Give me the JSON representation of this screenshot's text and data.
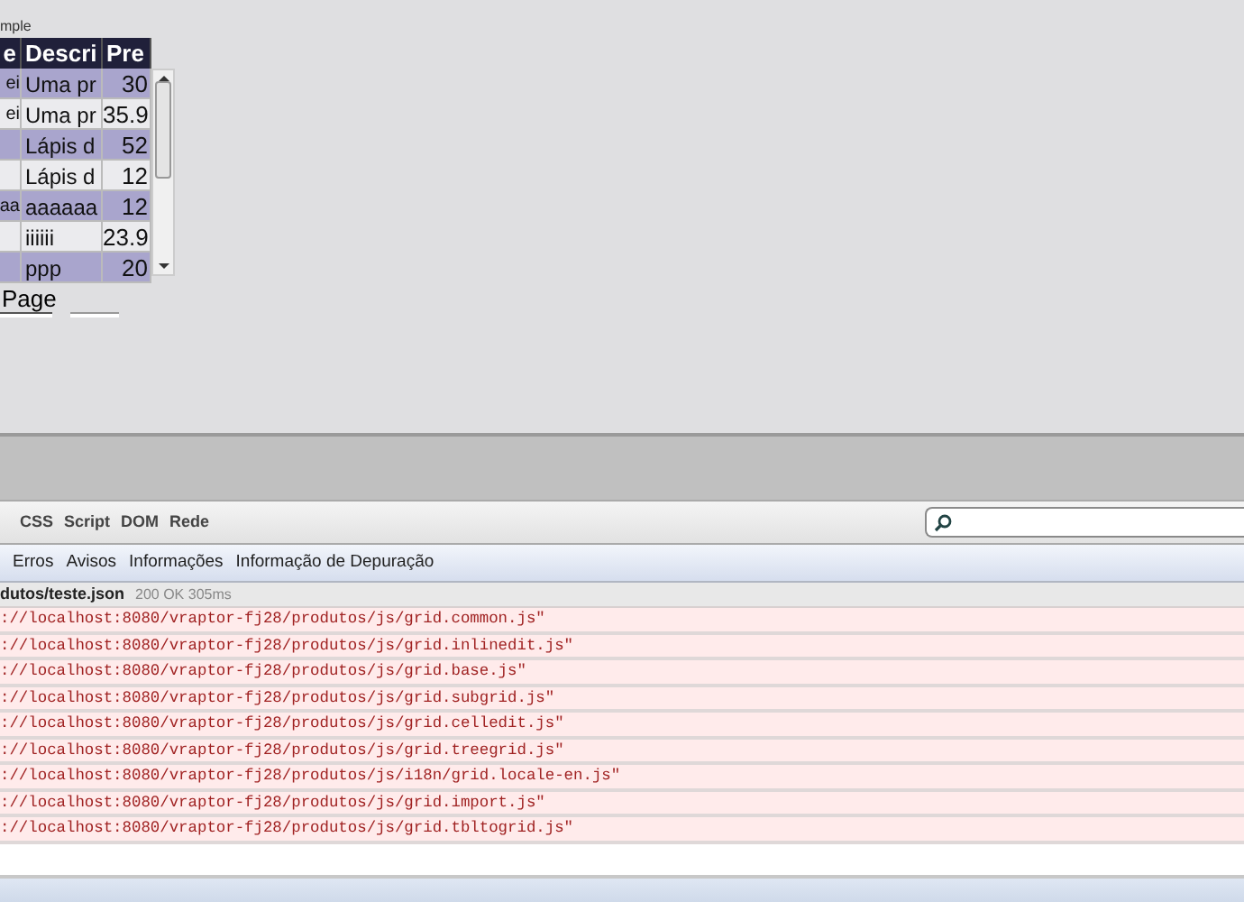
{
  "grid": {
    "caption": "mple",
    "columns": [
      "e",
      "Descri",
      "Pre"
    ],
    "rows": [
      [
        "ei",
        "Uma pr",
        "30"
      ],
      [
        "ei",
        "Uma pr",
        "35.9"
      ],
      [
        "",
        "Lápis d",
        "52"
      ],
      [
        "",
        "Lápis d",
        "12"
      ],
      [
        "aa",
        "aaaaaa",
        "12"
      ],
      [
        "",
        "iiiiii",
        "23.9"
      ],
      [
        "",
        "ppp",
        "20"
      ]
    ],
    "pager_label": "Page"
  },
  "console": {
    "tabs": [
      {
        "label": "CSS",
        "selected": false
      },
      {
        "label": "Script",
        "selected": false
      },
      {
        "label": "DOM",
        "selected": false
      },
      {
        "label": "Rede",
        "selected": false
      }
    ],
    "filters": [
      {
        "label": "Erros",
        "selected": false
      },
      {
        "label": "Avisos",
        "selected": false
      },
      {
        "label": "Informações",
        "selected": false
      },
      {
        "label": "Informação de Depuração",
        "selected": false
      }
    ],
    "request": {
      "url": "dutos/teste.json",
      "status": "200 OK 305ms"
    },
    "messages": [
      "://localhost:8080/vraptor-fj28/produtos/js/grid.common.js\"",
      "://localhost:8080/vraptor-fj28/produtos/js/grid.inlinedit.js\"",
      "://localhost:8080/vraptor-fj28/produtos/js/grid.base.js\"",
      "://localhost:8080/vraptor-fj28/produtos/js/grid.subgrid.js\"",
      "://localhost:8080/vraptor-fj28/produtos/js/grid.celledit.js\"",
      "://localhost:8080/vraptor-fj28/produtos/js/grid.treegrid.js\"",
      "://localhost:8080/vraptor-fj28/produtos/js/i18n/grid.locale-en.js\"",
      "://localhost:8080/vraptor-fj28/produtos/js/grid.import.js\"",
      "://localhost:8080/vraptor-fj28/produtos/js/grid.tbltogrid.js\""
    ]
  }
}
